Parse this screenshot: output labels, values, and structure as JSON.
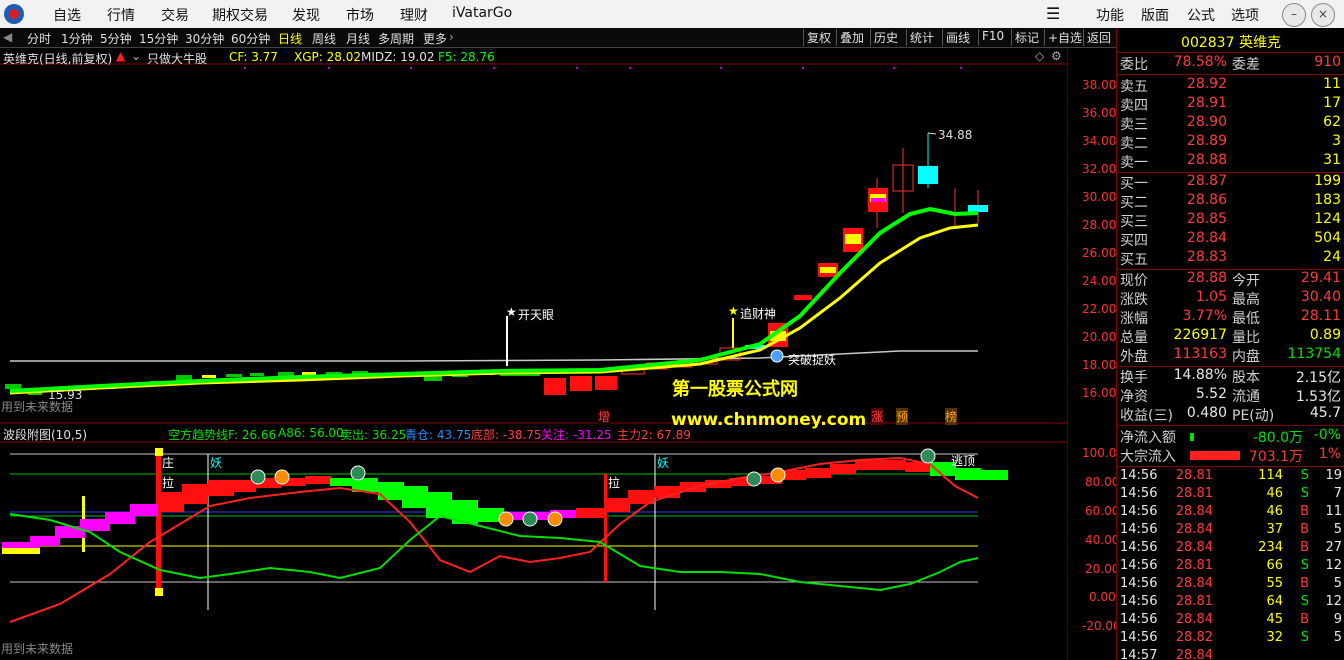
{
  "menubar": {
    "items": [
      "自选",
      "行情",
      "交易",
      "期权交易",
      "发现",
      "市场",
      "理财",
      "iVatarGo"
    ],
    "right_items": [
      "功能",
      "版面",
      "公式",
      "选项"
    ]
  },
  "periods": {
    "items": [
      "分时",
      "1分钟",
      "5分钟",
      "15分钟",
      "30分钟",
      "60分钟",
      "日线",
      "周线",
      "月线",
      "多周期",
      "更多"
    ],
    "active": "日线",
    "tools": [
      "复权",
      "叠加",
      "历史",
      "统计",
      "画线",
      "F10",
      "标记",
      "+自选",
      "返回"
    ]
  },
  "main_chart": {
    "title": "英维克(日线,前复权)",
    "formula": "只做大牛股",
    "indicators": [
      {
        "label": "CF: 3.77",
        "color": "#ffff00"
      },
      {
        "label": "XGP: 28.02",
        "color": "#ffff00"
      },
      {
        "label": "MIDZ: 19.02",
        "color": "#e0e0e0"
      },
      {
        "label": "F5: 28.76",
        "color": "#00ff00"
      }
    ],
    "y_ticks": [
      "38.00",
      "36.00",
      "34.00",
      "32.00",
      "30.00",
      "28.00",
      "26.00",
      "24.00",
      "22.00",
      "20.00",
      "18.00",
      "16.00"
    ],
    "high_label": "34.88",
    "low_label": "15.93",
    "signals": [
      "开天眼",
      "追财神",
      "突破捉妖"
    ],
    "watermark_title": "第一股票公式网",
    "watermark_url": "www.chnmoney.com",
    "future_note": "用到未来数据",
    "bottom_marks": [
      "增",
      "涨",
      "预",
      "榜"
    ]
  },
  "sub_chart": {
    "title": "波段附图(10,5)",
    "indicators": [
      {
        "label": "空方趋势线F: 26.66",
        "color": "#00e000"
      },
      {
        "label": "A86: 56.00",
        "color": "#00e000"
      },
      {
        "label": "卖出: 36.25",
        "color": "#00e000"
      },
      {
        "label": "青仓: 43.75",
        "color": "#1e90ff"
      },
      {
        "label": "底部: -38.75",
        "color": "#ff4040"
      },
      {
        "label": "关注: -31.25",
        "color": "#ff00ff"
      },
      {
        "label": "主力2: 67.89",
        "color": "#ff4040"
      }
    ],
    "y_ticks": [
      "100.00",
      "80.00",
      "60.00",
      "40.00",
      "20.00",
      "0.00",
      "-20.00"
    ],
    "markers": [
      "庄",
      "拉",
      "妖",
      "拉",
      "妖",
      "逃顶"
    ],
    "future_note": "用到未来数据"
  },
  "quote": {
    "code": "002837",
    "name": "英维克",
    "wb_label": "委比",
    "wb": "78.58%",
    "wc_label": "委差",
    "wc": "910",
    "asks": [
      {
        "label": "卖五",
        "price": "28.92",
        "vol": "11"
      },
      {
        "label": "卖四",
        "price": "28.91",
        "vol": "17"
      },
      {
        "label": "卖三",
        "price": "28.90",
        "vol": "62"
      },
      {
        "label": "卖二",
        "price": "28.89",
        "vol": "3"
      },
      {
        "label": "卖一",
        "price": "28.88",
        "vol": "31"
      }
    ],
    "bids": [
      {
        "label": "买一",
        "price": "28.87",
        "vol": "199"
      },
      {
        "label": "买二",
        "price": "28.86",
        "vol": "183"
      },
      {
        "label": "买三",
        "price": "28.85",
        "vol": "124"
      },
      {
        "label": "买四",
        "price": "28.84",
        "vol": "504"
      },
      {
        "label": "买五",
        "price": "28.83",
        "vol": "24"
      }
    ],
    "stats": [
      {
        "l1": "现价",
        "v1": "28.88",
        "c1": "red",
        "l2": "今开",
        "v2": "29.41",
        "c2": "red"
      },
      {
        "l1": "涨跌",
        "v1": "1.05",
        "c1": "red",
        "l2": "最高",
        "v2": "30.40",
        "c2": "red"
      },
      {
        "l1": "涨幅",
        "v1": "3.77%",
        "c1": "red",
        "l2": "最低",
        "v2": "28.11",
        "c2": "red"
      },
      {
        "l1": "总量",
        "v1": "226917",
        "c1": "yel",
        "l2": "量比",
        "v2": "0.89",
        "c2": "yel"
      },
      {
        "l1": "外盘",
        "v1": "113163",
        "c1": "red",
        "l2": "内盘",
        "v2": "113754",
        "c2": "grn"
      }
    ],
    "stats2": [
      {
        "l1": "换手",
        "v1": "14.88%",
        "l2": "股本",
        "v2": "2.15亿"
      },
      {
        "l1": "净资",
        "v1": "5.52",
        "l2": "流通",
        "v2": "1.53亿"
      },
      {
        "l1": "收益(三)",
        "v1": "0.480",
        "l2": "PE(动)",
        "v2": "45.7"
      }
    ],
    "flows": [
      {
        "label": "净流入额",
        "value": "-80.0万",
        "pct": "-0%",
        "vcolor": "grn"
      },
      {
        "label": "大宗流入",
        "value": "703.1万",
        "pct": "1%",
        "vcolor": "red"
      }
    ],
    "ticks": [
      {
        "t": "14:56",
        "p": "28.81",
        "v": "114",
        "s": "S",
        "n": "19"
      },
      {
        "t": "14:56",
        "p": "28.81",
        "v": "46",
        "s": "S",
        "n": "7"
      },
      {
        "t": "14:56",
        "p": "28.84",
        "v": "46",
        "s": "B",
        "n": "11"
      },
      {
        "t": "14:56",
        "p": "28.84",
        "v": "37",
        "s": "B",
        "n": "5"
      },
      {
        "t": "14:56",
        "p": "28.84",
        "v": "234",
        "s": "B",
        "n": "27"
      },
      {
        "t": "14:56",
        "p": "28.81",
        "v": "66",
        "s": "S",
        "n": "12"
      },
      {
        "t": "14:56",
        "p": "28.84",
        "v": "55",
        "s": "B",
        "n": "5"
      },
      {
        "t": "14:56",
        "p": "28.81",
        "v": "64",
        "s": "S",
        "n": "12"
      },
      {
        "t": "14:56",
        "p": "28.84",
        "v": "45",
        "s": "B",
        "n": "9"
      },
      {
        "t": "14:56",
        "p": "28.82",
        "v": "32",
        "s": "S",
        "n": "5"
      },
      {
        "t": "14:57",
        "p": "28.84",
        "v": "",
        "s": "",
        "n": ""
      }
    ]
  }
}
